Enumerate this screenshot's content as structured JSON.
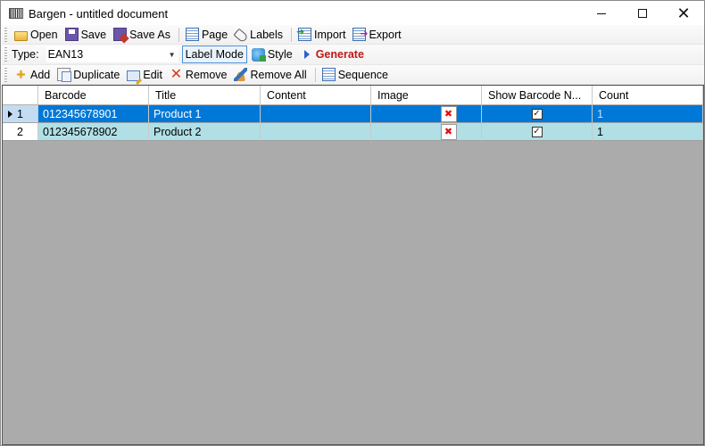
{
  "window": {
    "title": "Bargen - untitled document",
    "icon": "barcode-app-icon",
    "controls": {
      "minimize": "minimize",
      "maximize": "maximize",
      "close": "✕"
    }
  },
  "toolbar_file": {
    "items": [
      {
        "label": "Open",
        "icon": "folder-open-icon"
      },
      {
        "label": "Save",
        "icon": "floppy-save-icon"
      },
      {
        "label": "Save As",
        "icon": "save-as-icon"
      },
      {
        "label": "Page",
        "icon": "page-icon"
      },
      {
        "label": "Labels",
        "icon": "tag-icon"
      },
      {
        "label": "Import",
        "icon": "import-icon"
      },
      {
        "label": "Export",
        "icon": "export-icon"
      }
    ]
  },
  "toolbar_type": {
    "type_label": "Type:",
    "type_value": "EAN13",
    "label_mode": "Label Mode",
    "style": "Style",
    "generate": "Generate",
    "generate_color": "#c01717"
  },
  "toolbar_rows": {
    "items": [
      {
        "label": "Add",
        "icon": "plus-icon"
      },
      {
        "label": "Duplicate",
        "icon": "duplicate-icon"
      },
      {
        "label": "Edit",
        "icon": "edit-icon"
      },
      {
        "label": "Remove",
        "icon": "red-x-icon"
      },
      {
        "label": "Remove All",
        "icon": "broom-icon"
      },
      {
        "label": "Sequence",
        "icon": "sequence-icon"
      }
    ]
  },
  "grid": {
    "columns": [
      "Barcode",
      "Title",
      "Content",
      "Image",
      "Show Barcode N...",
      "Count"
    ],
    "rows": [
      {
        "num": "1",
        "barcode": "012345678901",
        "title": "Product 1",
        "content": "",
        "image": "broken-image",
        "show_barcode_number": true,
        "count": "1",
        "selected": true
      },
      {
        "num": "2",
        "barcode": "012345678902",
        "title": "Product 2",
        "content": "",
        "image": "broken-image",
        "show_barcode_number": true,
        "count": "1",
        "selected": false
      }
    ],
    "colors": {
      "selected": "#0078d7",
      "row": "#b0e0e6",
      "empty_area": "#ababab"
    }
  }
}
